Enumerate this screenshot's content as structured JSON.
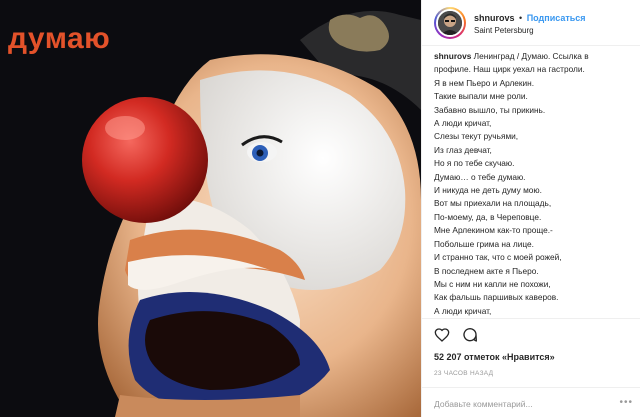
{
  "photo": {
    "overlay_text": "думаю",
    "overlay_color": "#e3522a"
  },
  "header": {
    "username": "shnurovs",
    "separator": "•",
    "follow_label": "Подписаться",
    "location": "Saint Petersburg"
  },
  "caption": {
    "username": "shnurovs",
    "lines": [
      "Ленинград / Думаю. Ссылка в",
      "профиле. Наш цирк уехал на гастроли.",
      "Я в нем Пьеро и Арлекин.",
      "Такие выпали мне роли.",
      "Забавно вышло, ты прикинь.",
      "А люди кричат,",
      "Слезы текут ручьями,",
      "Из глаз девчат,",
      "Но я по тебе скучаю.",
      "Думаю… о тебе думаю.",
      "И никуда не деть думу мою.",
      "Вот мы приехали на площадь,",
      "По-моему, да, в Череповце.",
      "Мне Арлекином как-то проще.-",
      "Побольше грима на лице.",
      "И странно так, что с моей рожей,",
      "В последнем акте я Пьеро.",
      "Мы с ним ни капли не похожи,",
      "Как фальшь паршивых каверов.",
      "А люди кричат,"
    ]
  },
  "actions": {
    "like_icon": "heart-icon",
    "comment_icon": "comment-icon",
    "likes_text": "52 207 отметок «Нравится»",
    "time_text": "23 ЧАСОВ НАЗАД"
  },
  "comment_box": {
    "placeholder": "Добавьте комментарий...",
    "more_label": "•••"
  },
  "colors": {
    "accent": "#3897f0",
    "text": "#262626",
    "muted": "#999999",
    "border": "#efefef"
  }
}
